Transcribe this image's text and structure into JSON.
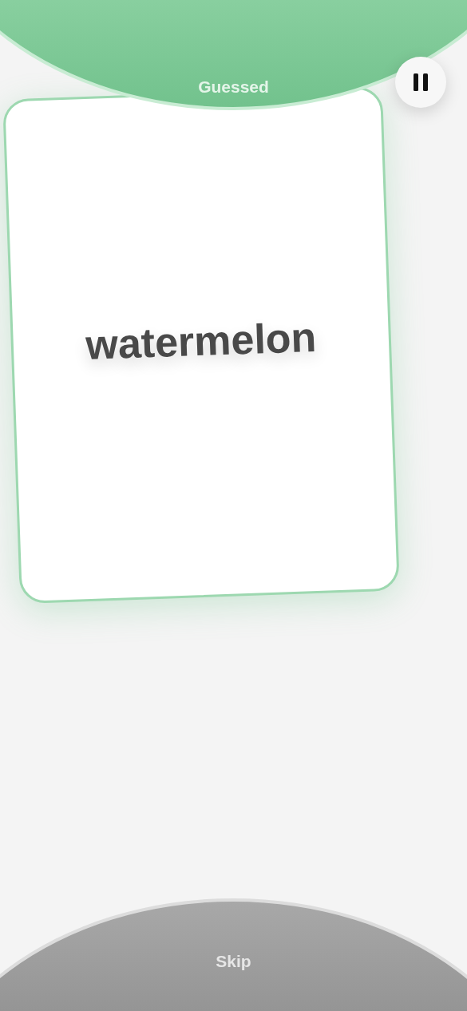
{
  "zones": [
    {
      "kind": "guessed",
      "label": "Guessed"
    },
    {
      "kind": "skip",
      "label": "Skip"
    }
  ],
  "card": {
    "word": "watermelon",
    "highlighted": true
  }
}
